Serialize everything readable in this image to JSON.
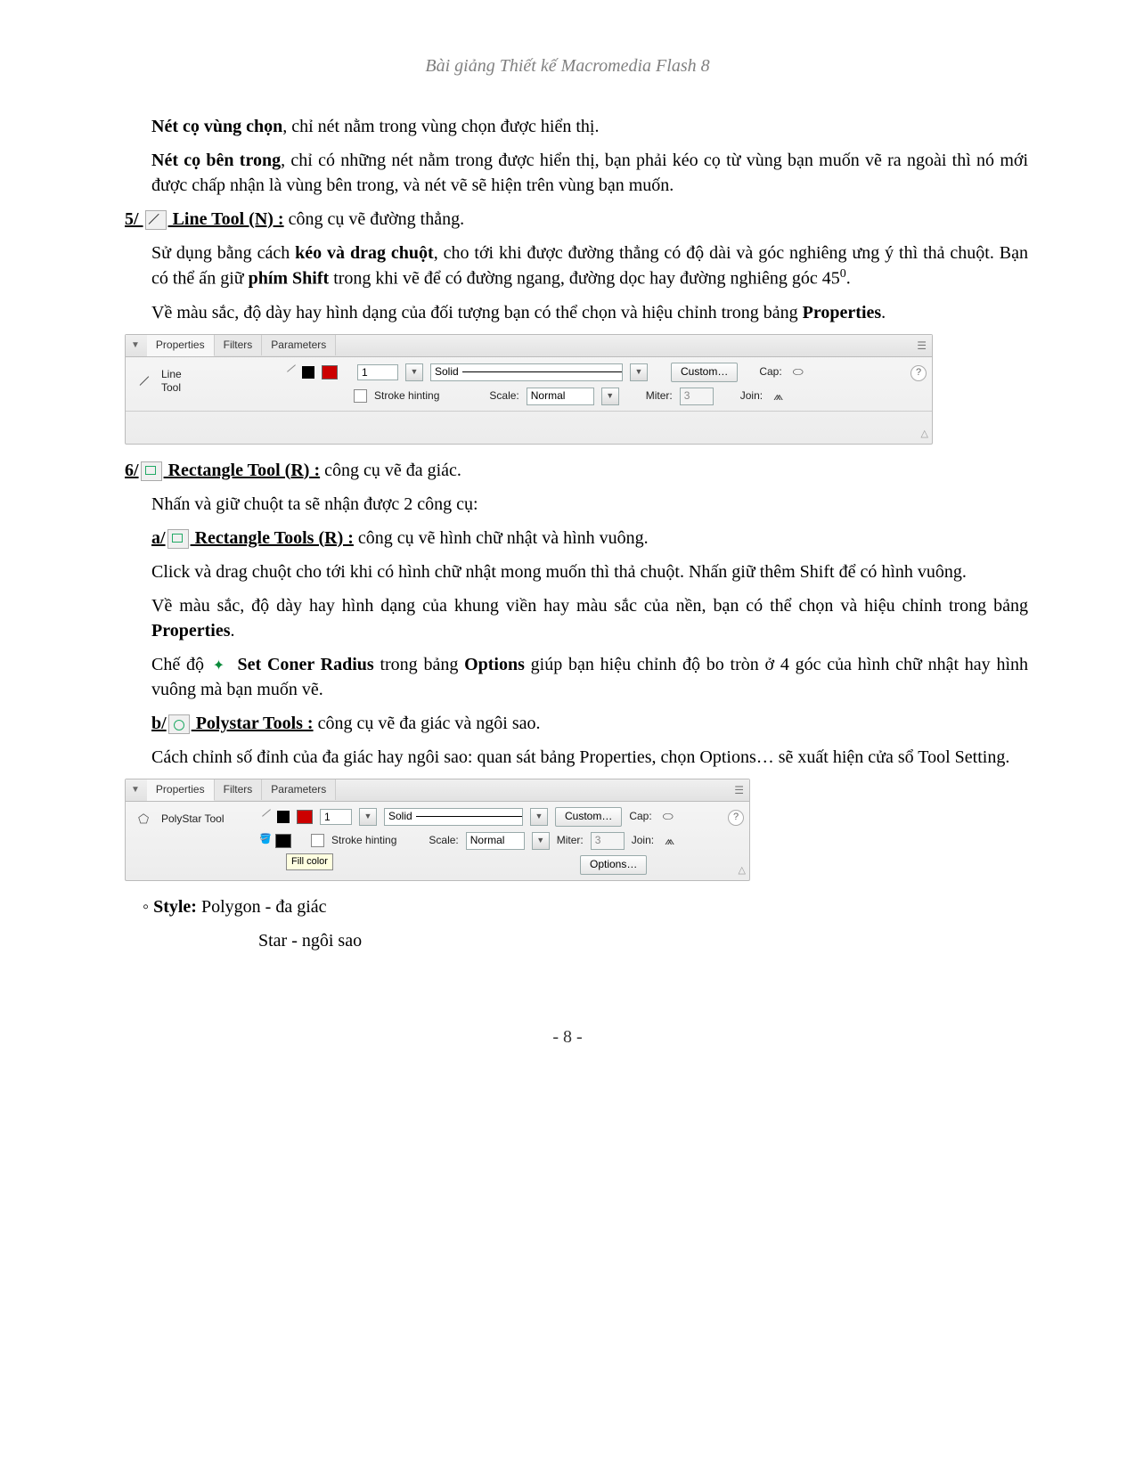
{
  "header": "Bài giảng Thiết kế Macromedia Flash 8",
  "p1a": "Nét cọ vùng chọn",
  "p1b": ", chỉ nét nằm trong vùng chọn được hiển thị.",
  "p2a": "Nét cọ bên trong",
  "p2b": ", chỉ có những nét nằm trong được hiển thị, bạn phải kéo cọ từ vùng bạn muốn vẽ ra ngoài thì nó mới được chấp nhận là vùng bên trong, và nét vẽ sẽ hiện trên vùng bạn muốn.",
  "s5_num": "5/ ",
  "s5_title": "  Line Tool (N) :",
  "s5_rest": " công cụ vẽ đường thẳng.",
  "p3a": "Sử dụng bằng cách ",
  "p3b": "kéo và drag chuột",
  "p3c": ", cho tới khi được đường thẳng có độ dài và góc nghiêng ưng ý thì thả chuột. Bạn có thể ấn giữ ",
  "p3d": "phím Shift",
  "p3e": " trong khi vẽ để có đường ngang, đường dọc hay đường nghiêng góc 45",
  "p3f": "0",
  "p3g": ".",
  "p4a": "Về màu sắc, độ dày hay hình dạng của đối tượng bạn có thể chọn và hiệu chỉnh trong bảng ",
  "p4b": "Properties",
  "p4c": ".",
  "panel1": {
    "tabs": [
      "Properties",
      "Filters",
      "Parameters"
    ],
    "tool": "Line\nTool",
    "stroke_w": "1",
    "style": "Solid",
    "custom": "Custom…",
    "cap": "Cap:",
    "hint": "Stroke hinting",
    "scale_lbl": "Scale:",
    "scale": "Normal",
    "miter_lbl": "Miter:",
    "miter": "3",
    "join": "Join:"
  },
  "s6_num": "6/",
  "s6_title": "  Rectangle Tool (R) :",
  "s6_rest": " công cụ vẽ đa giác.",
  "p5": "Nhấn và giữ chuột ta sẽ nhận được 2 công cụ:",
  "a_num": "a/",
  "a_title": "  Rectangle Tools (R) :",
  "a_rest": " công cụ vẽ hình chữ nhật và hình vuông.",
  "p6": "Click và drag chuột cho tới khi có hình chữ nhật mong muốn thì thả chuột. Nhấn giữ thêm Shift để có hình vuông.",
  "p7a": "Về màu sắc, độ dày hay hình dạng của khung viền hay màu sắc của nền, bạn có thể chọn và hiệu chỉnh trong bảng ",
  "p7b": "Properties",
  "p7c": ".",
  "p8a": "Chế độ ",
  "p8b": " Set Coner Radius",
  "p8c": " trong bảng ",
  "p8d": "Options",
  "p8e": " giúp bạn hiệu chỉnh độ bo tròn ở 4 góc của hình chữ nhật hay hình vuông mà bạn muốn vẽ.",
  "b_num": "b/",
  "b_title": "  Polystar Tools :",
  "b_rest": " công cụ vẽ đa giác và ngôi sao.",
  "p9": "Cách chỉnh số đỉnh của đa giác hay ngôi sao: quan sát bảng Properties, chọn Options… sẽ xuất hiện cửa sổ Tool Setting.",
  "panel2": {
    "tabs": [
      "Properties",
      "Filters",
      "Parameters"
    ],
    "tool": "PolyStar Tool",
    "stroke_w": "1",
    "style": "Solid",
    "custom": "Custom…",
    "cap": "Cap:",
    "hint": "Stroke hinting",
    "scale_lbl": "Scale:",
    "scale": "Normal",
    "miter_lbl": "Miter:",
    "miter": "3",
    "join": "Join:",
    "tooltip": "Fill color",
    "options": "Options…"
  },
  "p10a": "◦ ",
  "p10b": "Style:",
  "p10c": " Polygon - đa giác",
  "p11": "Star - ngôi sao",
  "page": "- 8 -"
}
